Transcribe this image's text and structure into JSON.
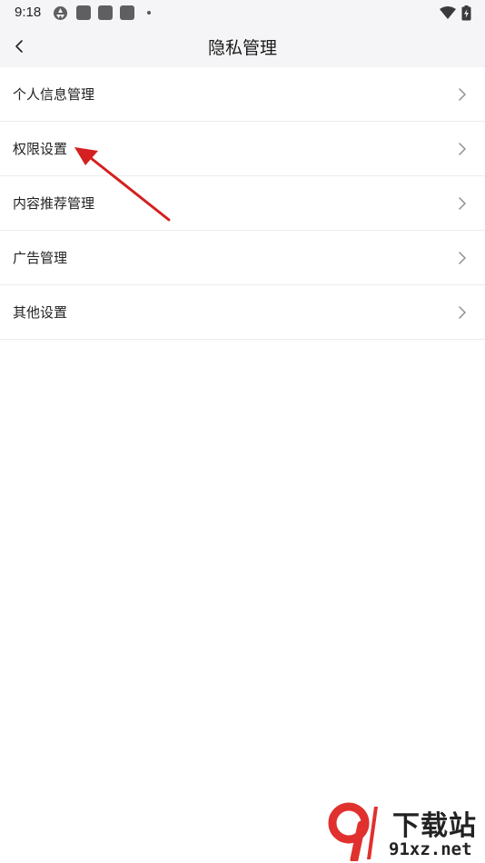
{
  "status_bar": {
    "time": "9:18",
    "icons": [
      "aperture-icon",
      "app-icon",
      "app-icon",
      "app-icon",
      "dot-icon",
      "wifi-icon",
      "battery-charging-icon"
    ]
  },
  "header": {
    "title": "隐私管理",
    "back_icon": "chevron-left-icon"
  },
  "list": {
    "items": [
      {
        "label": "个人信息管理"
      },
      {
        "label": "权限设置"
      },
      {
        "label": "内容推荐管理"
      },
      {
        "label": "广告管理"
      },
      {
        "label": "其他设置"
      }
    ]
  },
  "colors": {
    "header_bg": "#f5f5f7",
    "annotation_arrow": "#d42020",
    "watermark_red": "#e0312f"
  },
  "watermark": {
    "cn": "下载站",
    "en": "91xz.net"
  }
}
